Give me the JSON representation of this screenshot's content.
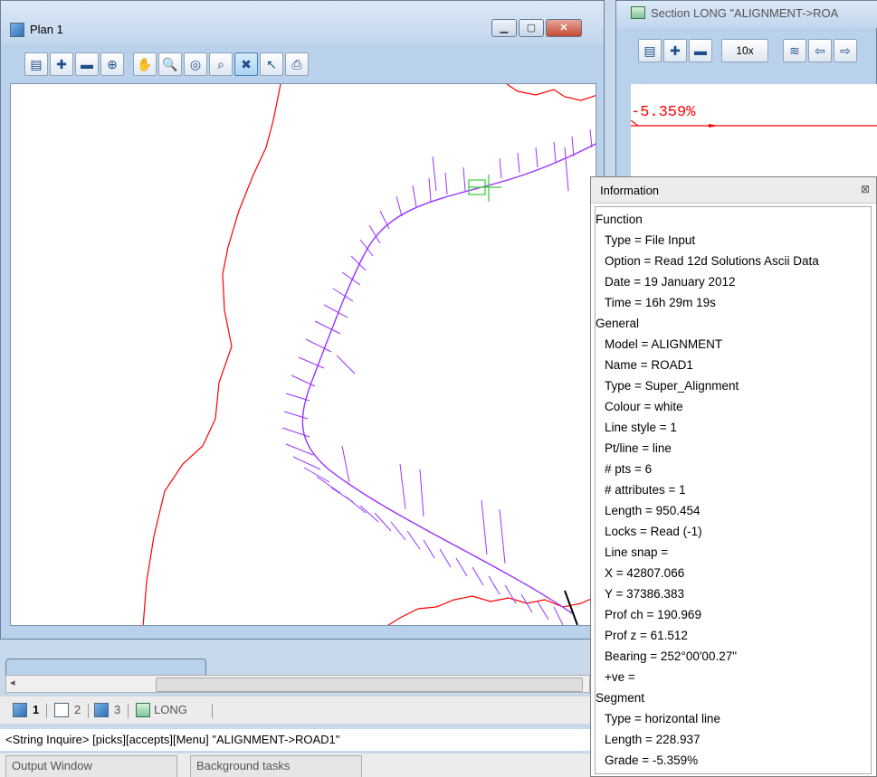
{
  "plan_window": {
    "title": "Plan 1",
    "window_controls": [
      "minimize",
      "maximize",
      "close"
    ],
    "toolbar_icons": [
      "print-icon",
      "zoom-in-icon",
      "zoom-out-icon",
      "zoom-fit-icon",
      "pan-icon",
      "zoom-window-icon",
      "zoom-target-icon",
      "zoom-extent-icon",
      "tracking-icon",
      "pick-icon",
      "plot-icon"
    ]
  },
  "section_window": {
    "title": "Section LONG \"ALIGNMENT->ROA",
    "zoom_label": "10x",
    "grade_label": "-5.359%"
  },
  "info_panel": {
    "title": "Information",
    "close_glyph": "⊠",
    "lines": [
      {
        "text": "Function",
        "indent": false
      },
      {
        "text": "Type = File Input",
        "indent": true
      },
      {
        "text": "Option = Read 12d Solutions Ascii Data",
        "indent": true
      },
      {
        "text": "Date = 19 January 2012",
        "indent": true
      },
      {
        "text": "Time = 16h 29m 19s",
        "indent": true
      },
      {
        "text": "General",
        "indent": false
      },
      {
        "text": "Model = ALIGNMENT",
        "indent": true
      },
      {
        "text": "Name = ROAD1",
        "indent": true
      },
      {
        "text": "Type = Super_Alignment",
        "indent": true
      },
      {
        "text": "Colour = white",
        "indent": true
      },
      {
        "text": "Line style = 1",
        "indent": true
      },
      {
        "text": "Pt/line = line",
        "indent": true
      },
      {
        "text": "# pts = 6",
        "indent": true
      },
      {
        "text": "# attributes = 1",
        "indent": true
      },
      {
        "text": "Length = 950.454",
        "indent": true
      },
      {
        "text": "Locks = Read (-1)",
        "indent": true
      },
      {
        "text": "Line snap =",
        "indent": true
      },
      {
        "text": "X = 42807.066",
        "indent": true
      },
      {
        "text": "Y = 37386.383",
        "indent": true
      },
      {
        "text": "Prof ch = 190.969",
        "indent": true
      },
      {
        "text": "Prof z = 61.512",
        "indent": true
      },
      {
        "text": "Bearing = 252°00'00.27\"",
        "indent": true
      },
      {
        "text": "+ve =",
        "indent": true
      },
      {
        "text": "Segment",
        "indent": false
      },
      {
        "text": "Type = horizontal line",
        "indent": true
      },
      {
        "text": "Length = 228.937",
        "indent": true
      },
      {
        "text": "Grade = -5.359%",
        "indent": true
      }
    ]
  },
  "view_tabs": [
    {
      "label": "1",
      "active": true
    },
    {
      "label": "2",
      "active": false
    },
    {
      "label": "3",
      "active": false
    },
    {
      "label": "LONG",
      "active": false
    }
  ],
  "status_line": "<String Inquire> [picks][accepts][Menu] \"ALIGNMENT->ROAD1\"",
  "bottom_tabs": [
    "Output Window",
    "Background tasks"
  ],
  "colors": {
    "boundary": "#ff0000",
    "alignment": "#9933ff",
    "cursor": "#33cc33"
  }
}
